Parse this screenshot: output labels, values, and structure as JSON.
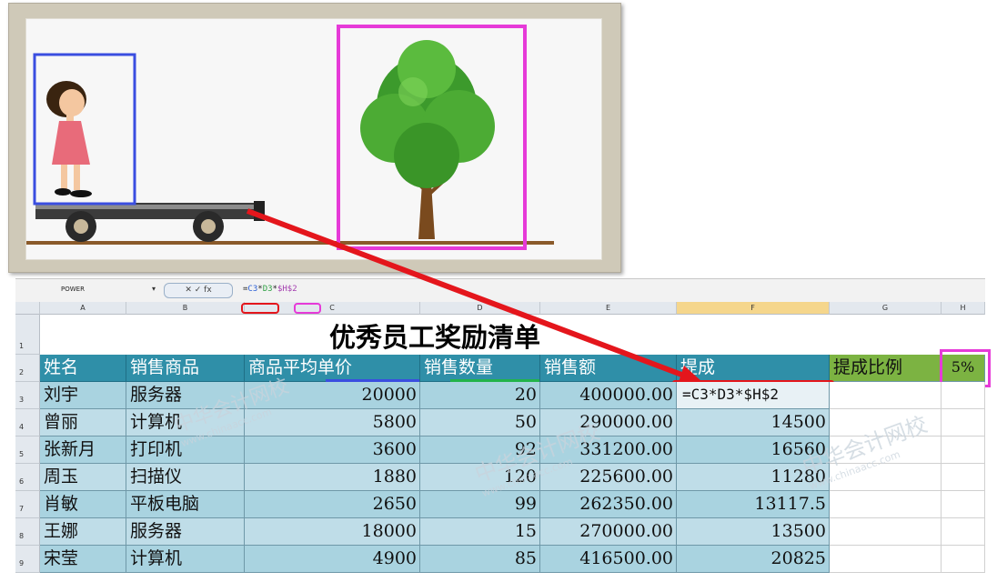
{
  "illustration": {
    "labels": []
  },
  "formula_bar": {
    "name_box": "POWER",
    "buttons": "✕ ✓ fx",
    "formula_parts": [
      {
        "text": "=",
        "color": "#222222"
      },
      {
        "text": "C3",
        "color": "#2b5fd6"
      },
      {
        "text": "*",
        "color": "#222222"
      },
      {
        "text": "D3",
        "color": "#2ea043"
      },
      {
        "text": "*",
        "color": "#222222"
      },
      {
        "text": "$H$2",
        "color": "#a43fb0"
      }
    ]
  },
  "columns": [
    "A",
    "B",
    "C",
    "D",
    "E",
    "F",
    "G",
    "H"
  ],
  "sheet": {
    "title": "优秀员工奖励清单",
    "headers": [
      "姓名",
      "销售商品",
      "商品平均单价",
      "销售数量",
      "销售额",
      "提成"
    ],
    "rate_label": "提成比例",
    "rate_value": "5%",
    "rows": [
      {
        "row": "3",
        "cells": [
          "刘宇",
          "服务器",
          "20000",
          "20",
          "400000.00",
          "=C3*D3*$H$2"
        ]
      },
      {
        "row": "4",
        "cells": [
          "曾丽",
          "计算机",
          "5800",
          "50",
          "290000.00",
          "14500"
        ]
      },
      {
        "row": "5",
        "cells": [
          "张新月",
          "打印机",
          "3600",
          "92",
          "331200.00",
          "16560"
        ]
      },
      {
        "row": "6",
        "cells": [
          "周玉",
          "扫描仪",
          "1880",
          "120",
          "225600.00",
          "11280"
        ]
      },
      {
        "row": "7",
        "cells": [
          "肖敏",
          "平板电脑",
          "2650",
          "99",
          "262350.00",
          "13117.5"
        ]
      },
      {
        "row": "8",
        "cells": [
          "王娜",
          "服务器",
          "18000",
          "15",
          "270000.00",
          "13500"
        ]
      },
      {
        "row": "9",
        "cells": [
          "宋莹",
          "计算机",
          "4900",
          "85",
          "416500.00",
          "20825"
        ]
      }
    ]
  },
  "watermarks": [
    {
      "text": "中华会计网校",
      "sub": "www.chinaacc.com"
    },
    {
      "text": "中华会计网校",
      "sub": "www.chinaacc.com"
    },
    {
      "text": "中华会计网校",
      "sub": "www.chinaacc.com"
    }
  ],
  "colors": {
    "header_fill": "#2f8fa8",
    "body_fill": "#a9d3e0",
    "rate_fill": "#7cb342",
    "red_box": "#e4161c",
    "blue_box": "#3a4ee0",
    "green_box": "#22b34a",
    "magenta_box": "#e63ad8"
  }
}
